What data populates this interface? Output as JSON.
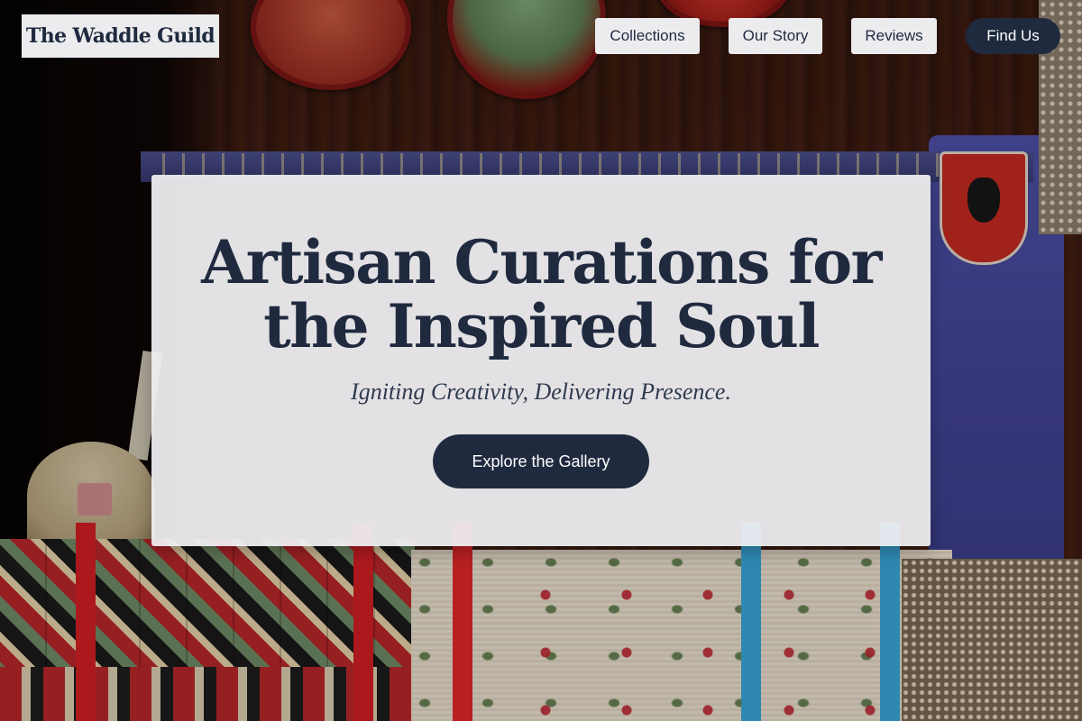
{
  "brand": {
    "name": "The Waddle Guild"
  },
  "nav": {
    "items": [
      {
        "label": "Collections"
      },
      {
        "label": "Our Story"
      },
      {
        "label": "Reviews"
      }
    ],
    "cta_label": "Find Us"
  },
  "hero": {
    "title": "Artisan Curations for the Inspired Soul",
    "subtitle": "Igniting Creativity, Delivering Presence.",
    "cta_label": "Explore the Gallery"
  },
  "colors": {
    "primary": "#1f2a3f",
    "surface": "#ececef",
    "on_primary": "#ffffff"
  }
}
